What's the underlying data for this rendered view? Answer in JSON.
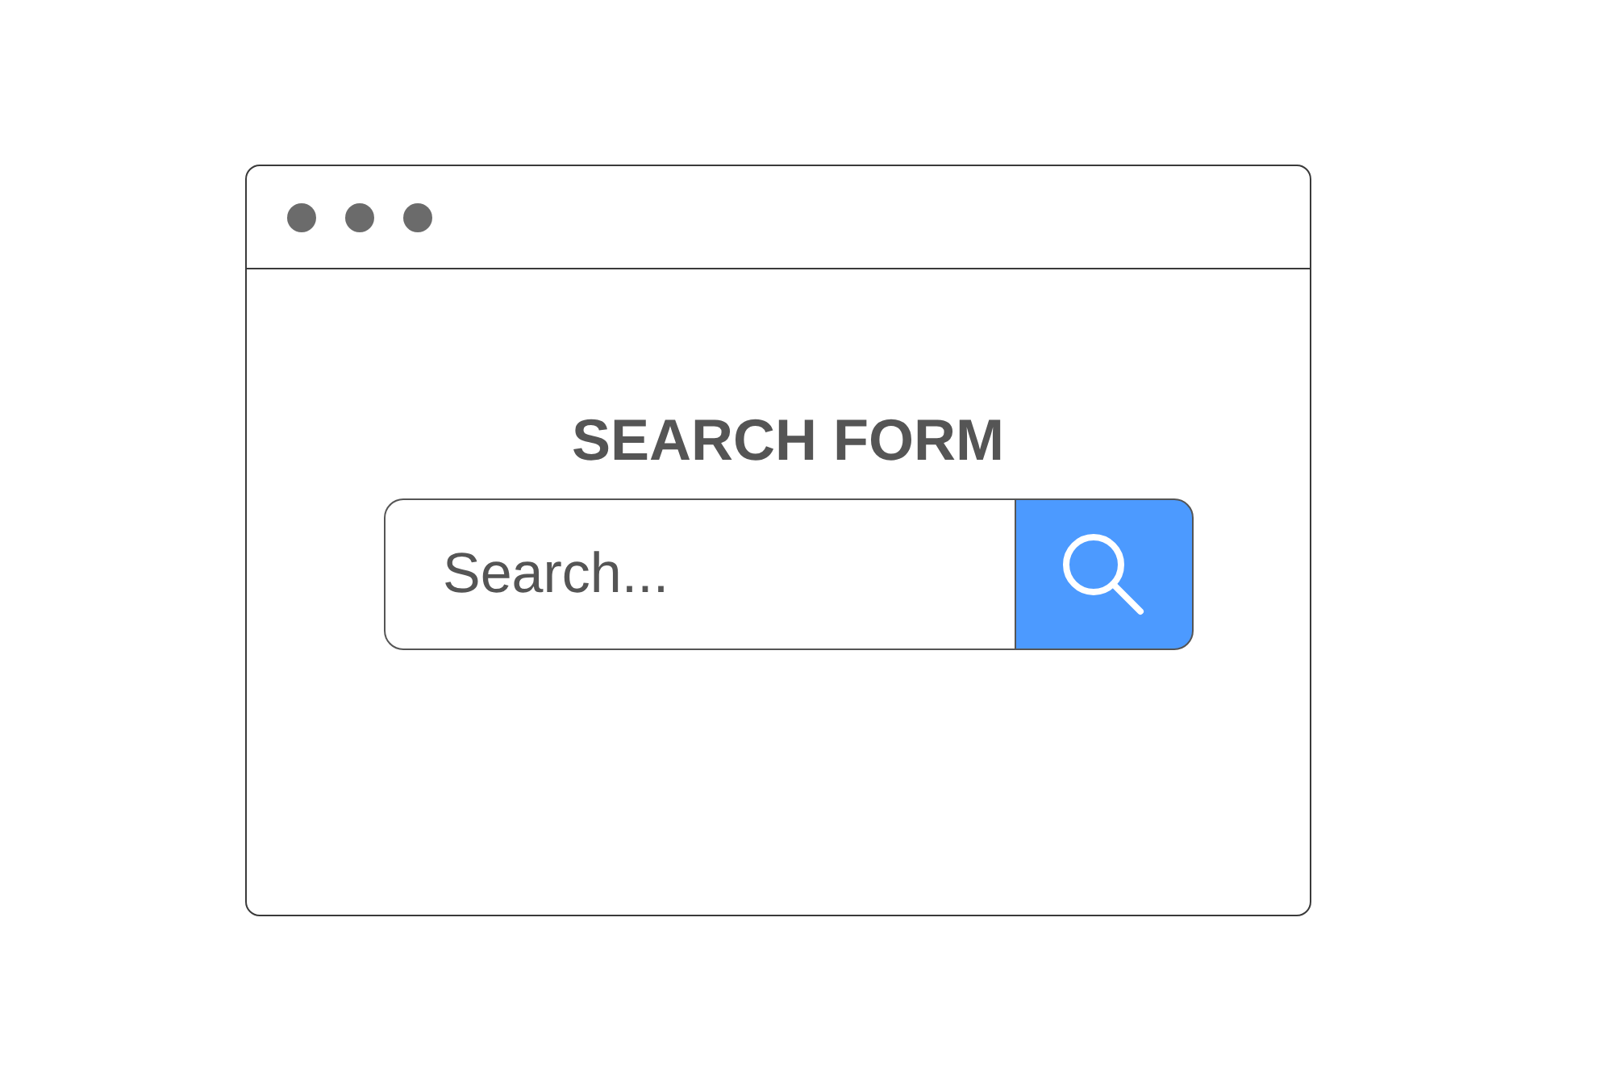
{
  "form": {
    "title": "SEARCH FORM",
    "search": {
      "placeholder": "Search..."
    }
  }
}
